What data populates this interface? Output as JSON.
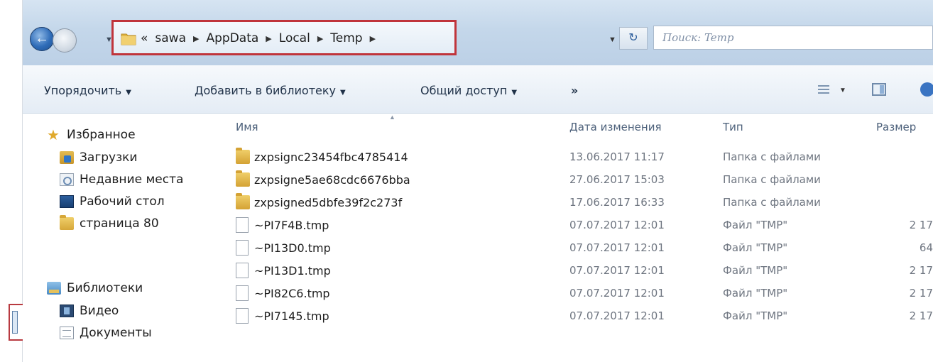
{
  "window": {
    "title": "Temp"
  },
  "address_bar": {
    "history_arrow": "▼",
    "overflow": "«",
    "breadcrumbs": [
      "sawa",
      "AppData",
      "Local",
      "Temp"
    ],
    "separator": "▶",
    "dropdown_arrow": "▼",
    "refresh_symbol": "↻",
    "search_placeholder": "Поиск: Temp",
    "highlight_color": "#c0343b"
  },
  "toolbar": {
    "organize": "Упорядочить",
    "add_to_library": "Добавить в библиотеку",
    "share": "Общий доступ",
    "more": "»",
    "caret": "▼"
  },
  "nav_pane": {
    "favorites": "Избранное",
    "downloads": "Загрузки",
    "recent": "Недавние места",
    "desktop": "Рабочий стол",
    "page80": "страница 80",
    "libraries": "Библиотеки",
    "video": "Видео",
    "documents": "Документы"
  },
  "columns": {
    "name": "Имя",
    "date": "Дата изменения",
    "type": "Тип",
    "size": "Размер"
  },
  "files": [
    {
      "icon": "folder-icon",
      "name": "zxpsignc23454fbc4785414",
      "date": "13.06.2017 11:17",
      "type": "Папка с файлами",
      "size": ""
    },
    {
      "icon": "folder-icon",
      "name": "zxpsigne5ae68cdc6676bba",
      "date": "27.06.2017 15:03",
      "type": "Папка с файлами",
      "size": ""
    },
    {
      "icon": "folder-icon",
      "name": "zxpsigned5dbfe39f2c273f",
      "date": "17.06.2017 16:33",
      "type": "Папка с файлами",
      "size": ""
    },
    {
      "icon": "file-icon",
      "name": "~PI7F4B.tmp",
      "date": "07.07.2017 12:01",
      "type": "Файл \"TMP\"",
      "size": "2 17"
    },
    {
      "icon": "file-icon",
      "name": "~PI13D0.tmp",
      "date": "07.07.2017 12:01",
      "type": "Файл \"TMP\"",
      "size": "64"
    },
    {
      "icon": "file-icon",
      "name": "~PI13D1.tmp",
      "date": "07.07.2017 12:01",
      "type": "Файл \"TMP\"",
      "size": "2 17"
    },
    {
      "icon": "file-icon",
      "name": "~PI82C6.tmp",
      "date": "07.07.2017 12:01",
      "type": "Файл \"TMP\"",
      "size": "2 17"
    },
    {
      "icon": "file-icon",
      "name": "~PI7145.tmp",
      "date": "07.07.2017 12:01",
      "type": "Файл \"TMP\"",
      "size": "2 17"
    }
  ]
}
